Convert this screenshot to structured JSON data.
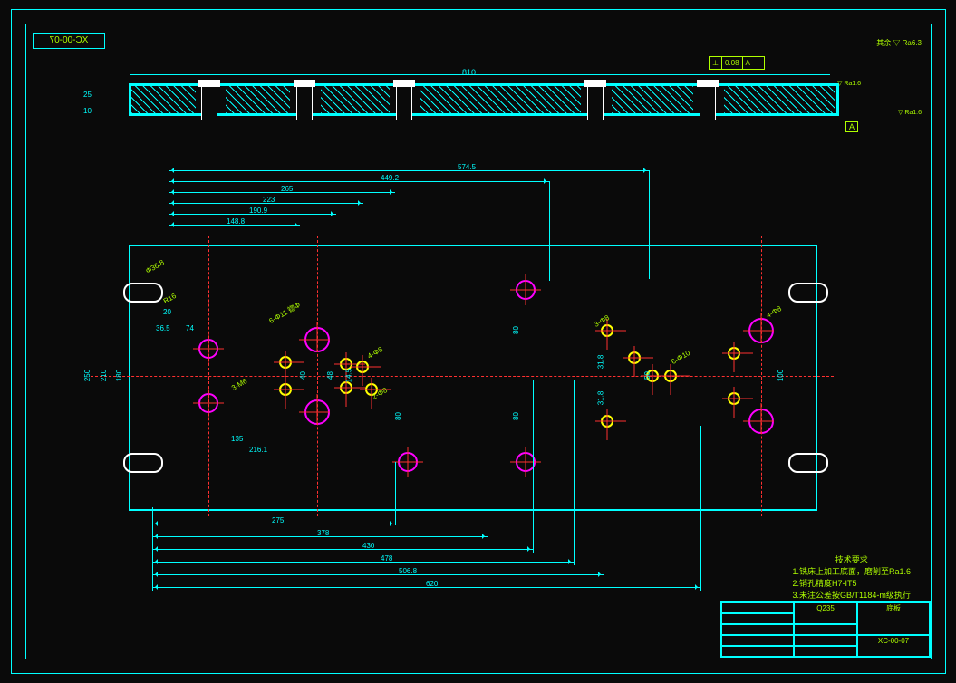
{
  "drawing_number_mirror": "XC-00-07",
  "surf_finish_main": "其余 ▽ Ra6.3",
  "geo_tol": {
    "sym": "⊥",
    "val": "0.08",
    "datum": "A"
  },
  "section": {
    "width": "810",
    "h1": "25",
    "h2": "10"
  },
  "surf_ra16_1": "▽ Ra1.6",
  "surf_ra16_2": "▽ Ra1.6",
  "datum_label": "A",
  "dims_top": [
    "574.5",
    "449.2",
    "265",
    "223",
    "190.9",
    "148.8"
  ],
  "dims_bot": [
    "275",
    "378",
    "430",
    "478",
    "506.8",
    "620"
  ],
  "dims_left": {
    "d1": "20",
    "d2": "36.5",
    "d3": "135",
    "d4": "216.1",
    "d5": "74"
  },
  "dims_v": {
    "h1": "250",
    "h2": "210",
    "h3": "180",
    "mid1": "40",
    "mid2": "48",
    "mid3": "14.5",
    "r1": "80",
    "r2": "80",
    "r3": "80",
    "r4": "31.8",
    "r5": "31.8",
    "r6": "50",
    "r7": "100"
  },
  "callouts": {
    "c1": "Φ36.8",
    "c2": "R16",
    "c3": "3-M6",
    "c4": "6-Φ11 锪Φ",
    "c5": "4-Φ8",
    "c6": "2-Φ8",
    "c7": "3-Φ8",
    "c8": "6-Φ10",
    "c9": "4-Φ8"
  },
  "notes_title": "技术要求",
  "notes": [
    "1.铣床上加工底面，磨削至Ra1.6",
    "2.销孔精度H7-IT5",
    "3.未注公差按GB/T1184-m级执行"
  ],
  "titleblock": {
    "material": "Q235",
    "part_name": "底板",
    "dwg_no": "XC-00-07"
  }
}
